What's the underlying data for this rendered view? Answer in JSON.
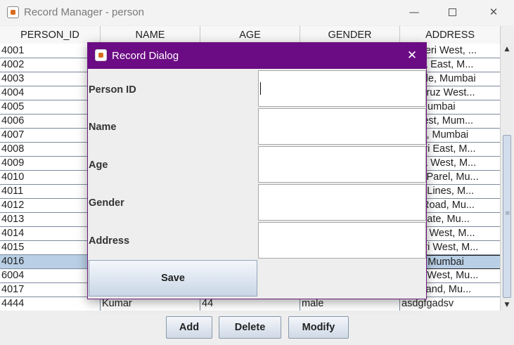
{
  "window": {
    "title": "Record Manager - person",
    "minimize": "—",
    "close": "✕"
  },
  "table": {
    "columns": [
      "PERSON_ID",
      "NAME",
      "AGE",
      "GENDER",
      "ADDRESS"
    ],
    "rows": [
      {
        "id": "4001",
        "name": "",
        "age": "",
        "gender": "",
        "address": "Andheri West, ..."
      },
      {
        "id": "4002",
        "name": "",
        "age": "",
        "gender": "",
        "address": "andra East, M..."
      },
      {
        "id": "4003",
        "name": "",
        "age": "",
        "gender": "",
        "address": "e Parle, Mumbai"
      },
      {
        "id": "4004",
        "name": "",
        "age": "",
        "gender": "",
        "address": "antacruz West..."
      },
      {
        "id": "4005",
        "name": "",
        "age": "",
        "gender": "",
        "address": "ort, Mumbai"
      },
      {
        "id": "4006",
        "name": "",
        "age": "",
        "gender": "",
        "address": "ar West, Mum..."
      },
      {
        "id": "4007",
        "name": "",
        "age": "",
        "gender": "",
        "address": "olaba, Mumbai"
      },
      {
        "id": "4008",
        "name": "",
        "age": "",
        "gender": "",
        "address": "ndheri East, M..."
      },
      {
        "id": "4009",
        "name": "",
        "age": "",
        "gender": "",
        "address": "andra West, M..."
      },
      {
        "id": "4010",
        "name": "",
        "age": "",
        "gender": "",
        "address": "ower Parel, Mu..."
      },
      {
        "id": "4011",
        "name": "",
        "age": "",
        "gender": "",
        "address": "arine Lines, M..."
      },
      {
        "id": "4012",
        "name": "",
        "age": "",
        "gender": "",
        "address": "rant Road, Mu..."
      },
      {
        "id": "4013",
        "name": "",
        "age": "",
        "gender": "",
        "address": "urchgate, Mu..."
      },
      {
        "id": "4014",
        "name": "",
        "age": "",
        "gender": "",
        "address": "ulund West, M..."
      },
      {
        "id": "4015",
        "name": "",
        "age": "",
        "gender": "",
        "address": "ndheri West, M..."
      },
      {
        "id": "4016",
        "name": "",
        "age": "",
        "gender": "",
        "address": "Vorli, Mumbai"
      },
      {
        "id": "6004",
        "name": "",
        "age": "",
        "gender": "",
        "address": "dheri West, Mu..."
      },
      {
        "id": "4017",
        "name": "",
        "age": "",
        "gender": "",
        "address": "dh Island, Mu..."
      },
      {
        "id": "4444",
        "name": "Kumar",
        "age": "44",
        "gender": "male",
        "address": "asdgfgadsv"
      }
    ],
    "selected_id": "4016"
  },
  "scrollbar": {
    "up_arrow": "▲",
    "down_arrow": "▼"
  },
  "buttons": {
    "add": "Add",
    "delete": "Delete",
    "modify": "Modify"
  },
  "dialog": {
    "title": "Record Dialog",
    "close": "✕",
    "fields": [
      {
        "label": "Person ID",
        "value": ""
      },
      {
        "label": "Name",
        "value": ""
      },
      {
        "label": "Age",
        "value": ""
      },
      {
        "label": "Gender",
        "value": ""
      },
      {
        "label": "Address",
        "value": ""
      }
    ],
    "save_label": "Save"
  },
  "colors": {
    "dialog_titlebar": "#6c0c84",
    "selected_row": "#b8cfe5"
  }
}
